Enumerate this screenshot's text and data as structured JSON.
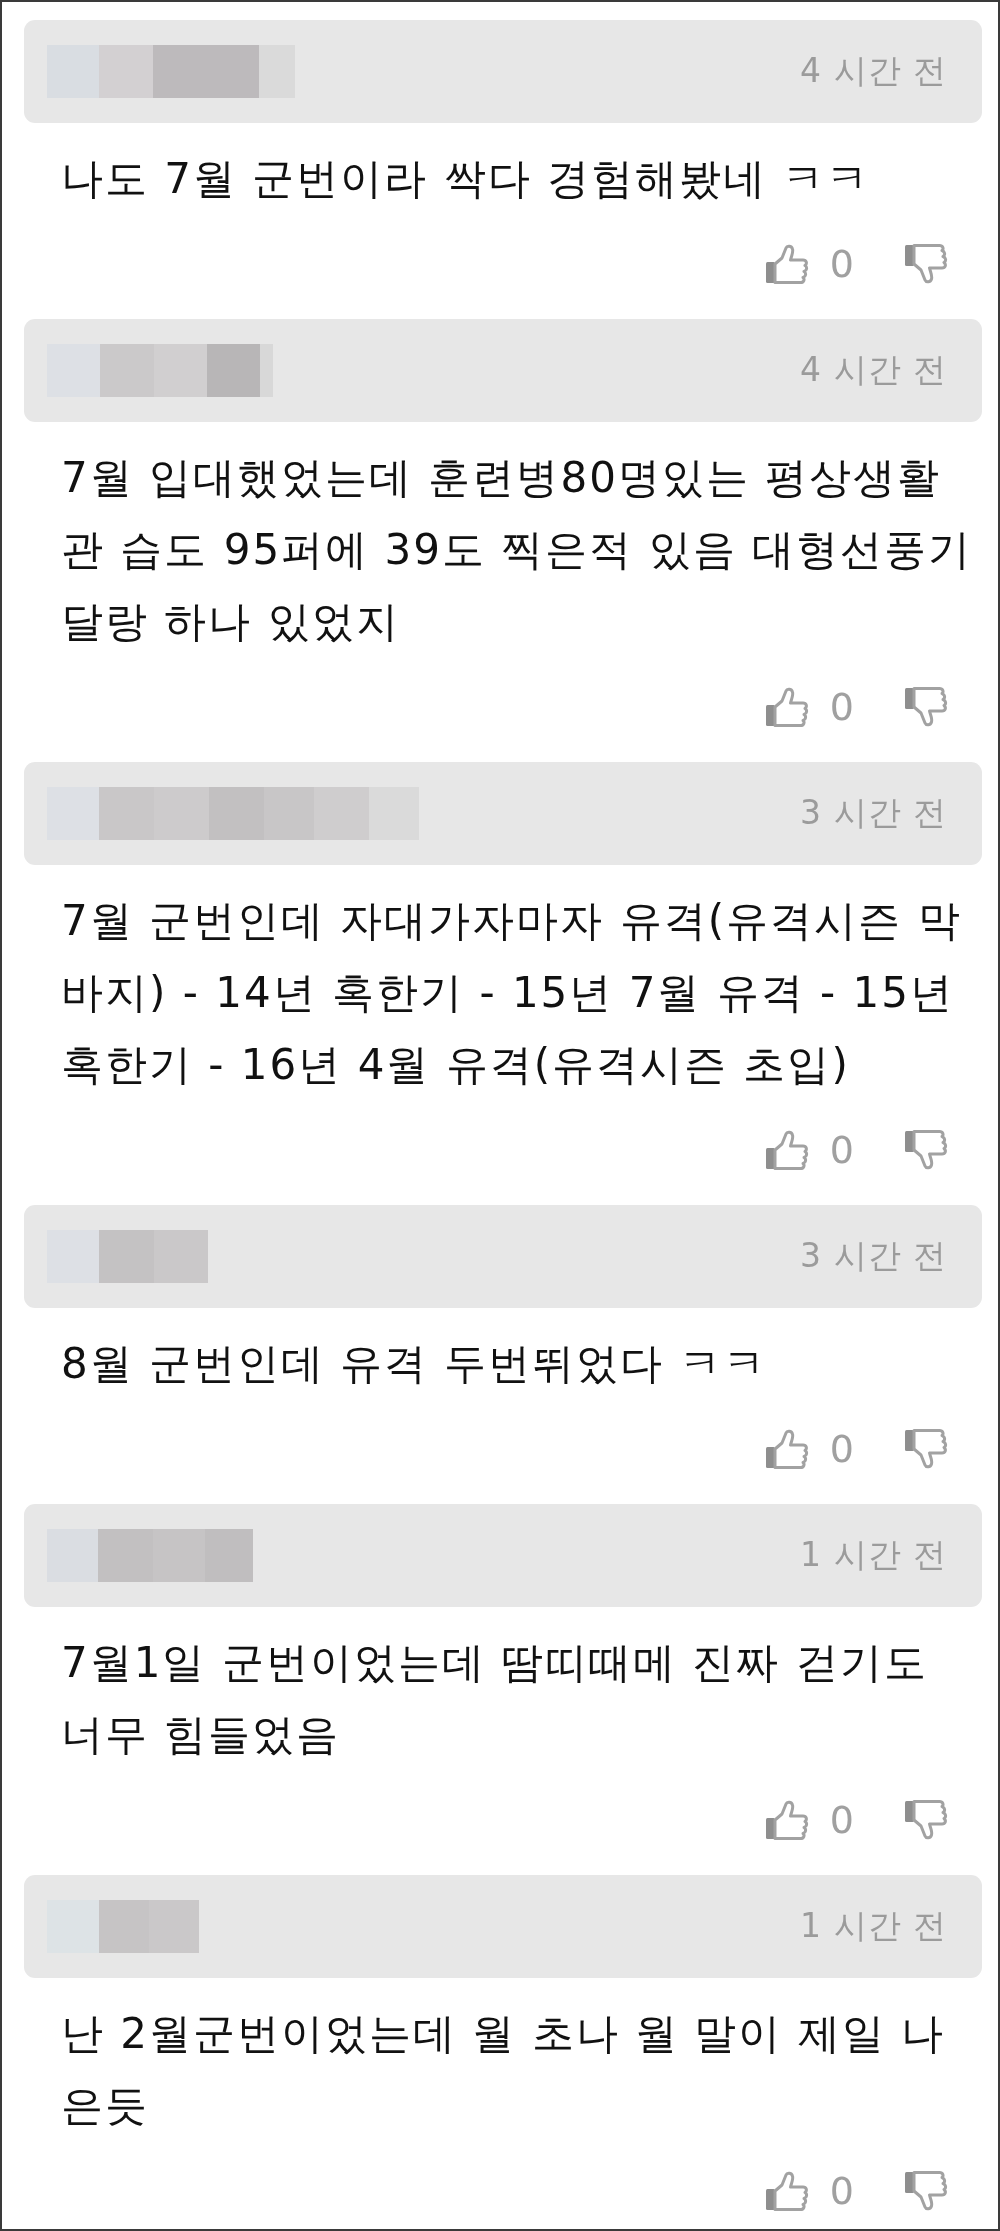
{
  "comments": [
    {
      "time": "4 시간 전",
      "text": "나도 7월 군번이라 싹다 경험해봤네 ㅋㅋ",
      "likes": "0"
    },
    {
      "time": "4 시간 전",
      "text": "7월 입대했었는데 훈련병80명있는 평상생활관 습도 95퍼에 39도 찍은적 있음 대형선풍기 달랑 하나 있었지",
      "likes": "0"
    },
    {
      "time": "3 시간 전",
      "text": "7월 군번인데 자대가자마자 유격(유격시즌 막바지) - 14년 혹한기 - 15년 7월 유격 - 15년 혹한기 - 16년 4월 유격(유격시즌 초입)",
      "likes": "0"
    },
    {
      "time": "3 시간 전",
      "text": "8월 군번인데 유격 두번뛰었다 ㅋㅋ",
      "likes": "0"
    },
    {
      "time": "1 시간 전",
      "text": "7월1일 군번이었는데 땀띠때메 진짜 걷기도 너무 힘들었음",
      "likes": "0"
    },
    {
      "time": "1 시간 전",
      "text": "난 2월군번이었는데 월 초나 월 말이 제일 나은듯",
      "likes": "0"
    }
  ]
}
